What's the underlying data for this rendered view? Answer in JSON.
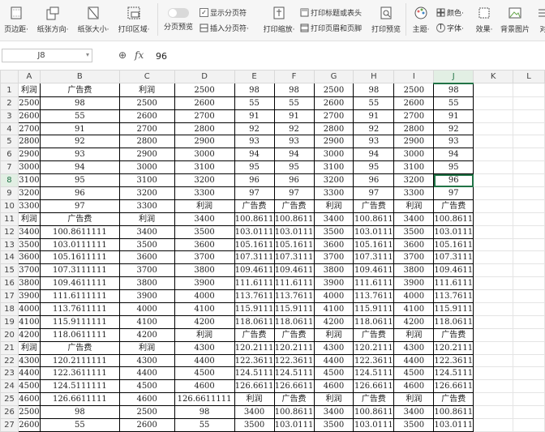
{
  "ribbon": {
    "items": [
      {
        "label": "页边距·",
        "icon": "margins-icon"
      },
      {
        "label": "纸张方向·",
        "icon": "orientation-icon"
      },
      {
        "label": "纸张大小·",
        "icon": "paper-size-icon"
      },
      {
        "label": "打印区域·",
        "icon": "print-area-icon"
      },
      {
        "label": "分页预览",
        "icon": "page-break-toggle-icon"
      },
      {
        "label": "打印缩放·",
        "icon": "print-scale-icon"
      },
      {
        "label": "打印预览",
        "icon": "print-preview-icon"
      },
      {
        "label": "主题·",
        "icon": "theme-icon"
      },
      {
        "label": "背景图片",
        "icon": "background-image-icon"
      },
      {
        "label": "对",
        "icon": "align-icon"
      }
    ],
    "show_page_break": "显示分页符",
    "insert_page_break": "插入分页符·",
    "print_titles": "打印标题或表头",
    "print_header_footer": "打印页眉和页脚",
    "colors": "颜色·",
    "fonts": "字体·",
    "effects": "效果·"
  },
  "formula_bar": {
    "name_box": "J8",
    "fx_label": "fx",
    "value": "96"
  },
  "grid": {
    "columns": [
      "A",
      "B",
      "C",
      "D",
      "E",
      "F",
      "G",
      "H",
      "I",
      "J",
      "K",
      "L"
    ],
    "selected_column": "J",
    "selected_row": 8,
    "rows": [
      {
        "n": "1",
        "cells": [
          "利润",
          "广告费",
          "利润",
          "2500",
          "98",
          "98",
          "2500",
          "98",
          "2500",
          "98"
        ]
      },
      {
        "n": "2",
        "cells": [
          "2500",
          "98",
          "2500",
          "2600",
          "55",
          "55",
          "2600",
          "55",
          "2600",
          "55"
        ]
      },
      {
        "n": "3",
        "cells": [
          "2600",
          "55",
          "2600",
          "2700",
          "91",
          "91",
          "2700",
          "91",
          "2700",
          "91"
        ]
      },
      {
        "n": "4",
        "cells": [
          "2700",
          "91",
          "2700",
          "2800",
          "92",
          "92",
          "2800",
          "92",
          "2800",
          "92"
        ]
      },
      {
        "n": "5",
        "cells": [
          "2800",
          "92",
          "2800",
          "2900",
          "93",
          "93",
          "2900",
          "93",
          "2900",
          "93"
        ]
      },
      {
        "n": "6",
        "cells": [
          "2900",
          "93",
          "2900",
          "3000",
          "94",
          "94",
          "3000",
          "94",
          "3000",
          "94"
        ]
      },
      {
        "n": "7",
        "cells": [
          "3000",
          "94",
          "3000",
          "3100",
          "95",
          "95",
          "3100",
          "95",
          "3100",
          "95"
        ]
      },
      {
        "n": "8",
        "cells": [
          "3100",
          "95",
          "3100",
          "3200",
          "96",
          "96",
          "3200",
          "96",
          "3200",
          "96"
        ]
      },
      {
        "n": "9",
        "cells": [
          "3200",
          "96",
          "3200",
          "3300",
          "97",
          "97",
          "3300",
          "97",
          "3300",
          "97"
        ]
      },
      {
        "n": "10",
        "cells": [
          "3300",
          "97",
          "3300",
          "利润",
          "广告费",
          "广告费",
          "利润",
          "广告费",
          "利润",
          "广告费"
        ]
      },
      {
        "n": "11",
        "cells": [
          "利润",
          "广告费",
          "利润",
          "3400",
          "100.8611",
          "100.8611",
          "3400",
          "100.8611",
          "3400",
          "100.8611"
        ]
      },
      {
        "n": "12",
        "cells": [
          "3400",
          "100.8611111",
          "3400",
          "3500",
          "103.0111",
          "103.0111",
          "3500",
          "103.0111",
          "3500",
          "103.0111"
        ]
      },
      {
        "n": "13",
        "cells": [
          "3500",
          "103.0111111",
          "3500",
          "3600",
          "105.1611",
          "105.1611",
          "3600",
          "105.1611",
          "3600",
          "105.1611"
        ]
      },
      {
        "n": "14",
        "cells": [
          "3600",
          "105.1611111",
          "3600",
          "3700",
          "107.3111",
          "107.3111",
          "3700",
          "107.3111",
          "3700",
          "107.3111"
        ]
      },
      {
        "n": "15",
        "cells": [
          "3700",
          "107.3111111",
          "3700",
          "3800",
          "109.4611",
          "109.4611",
          "3800",
          "109.4611",
          "3800",
          "109.4611"
        ]
      },
      {
        "n": "16",
        "cells": [
          "3800",
          "109.4611111",
          "3800",
          "3900",
          "111.6111",
          "111.6111",
          "3900",
          "111.6111",
          "3900",
          "111.6111"
        ]
      },
      {
        "n": "17",
        "cells": [
          "3900",
          "111.6111111",
          "3900",
          "4000",
          "113.7611",
          "113.7611",
          "4000",
          "113.7611",
          "4000",
          "113.7611"
        ]
      },
      {
        "n": "18",
        "cells": [
          "4000",
          "113.7611111",
          "4000",
          "4100",
          "115.9111",
          "115.9111",
          "4100",
          "115.9111",
          "4100",
          "115.9111"
        ]
      },
      {
        "n": "19",
        "cells": [
          "4100",
          "115.9111111",
          "4100",
          "4200",
          "118.0611",
          "118.0611",
          "4200",
          "118.0611",
          "4200",
          "118.0611"
        ]
      },
      {
        "n": "20",
        "cells": [
          "4200",
          "118.0611111",
          "4200",
          "利润",
          "广告费",
          "广告费",
          "利润",
          "广告费",
          "利润",
          "广告费"
        ]
      },
      {
        "n": "21",
        "cells": [
          "利润",
          "广告费",
          "利润",
          "4300",
          "120.2111",
          "120.2111",
          "4300",
          "120.2111",
          "4300",
          "120.2111"
        ]
      },
      {
        "n": "22",
        "cells": [
          "4300",
          "120.2111111",
          "4300",
          "4400",
          "122.3611",
          "122.3611",
          "4400",
          "122.3611",
          "4400",
          "122.3611"
        ]
      },
      {
        "n": "23",
        "cells": [
          "4400",
          "122.3611111",
          "4400",
          "4500",
          "124.5111",
          "124.5111",
          "4500",
          "124.5111",
          "4500",
          "124.5111"
        ]
      },
      {
        "n": "24",
        "cells": [
          "4500",
          "124.5111111",
          "4500",
          "4600",
          "126.6611",
          "126.6611",
          "4600",
          "126.6611",
          "4600",
          "126.6611"
        ]
      },
      {
        "n": "25",
        "cells": [
          "4600",
          "126.6611111",
          "4600",
          "126.6611111",
          "利润",
          "广告费",
          "利润",
          "广告费",
          "利润",
          "广告费"
        ]
      },
      {
        "n": "26",
        "cells": [
          "2500",
          "98",
          "2500",
          "98",
          "3400",
          "100.8611",
          "3400",
          "100.8611",
          "3400",
          "100.8611"
        ]
      },
      {
        "n": "27",
        "cells": [
          "2600",
          "55",
          "2600",
          "55",
          "3500",
          "103.0111",
          "3500",
          "103.0111",
          "3500",
          "103.0111"
        ]
      }
    ]
  }
}
